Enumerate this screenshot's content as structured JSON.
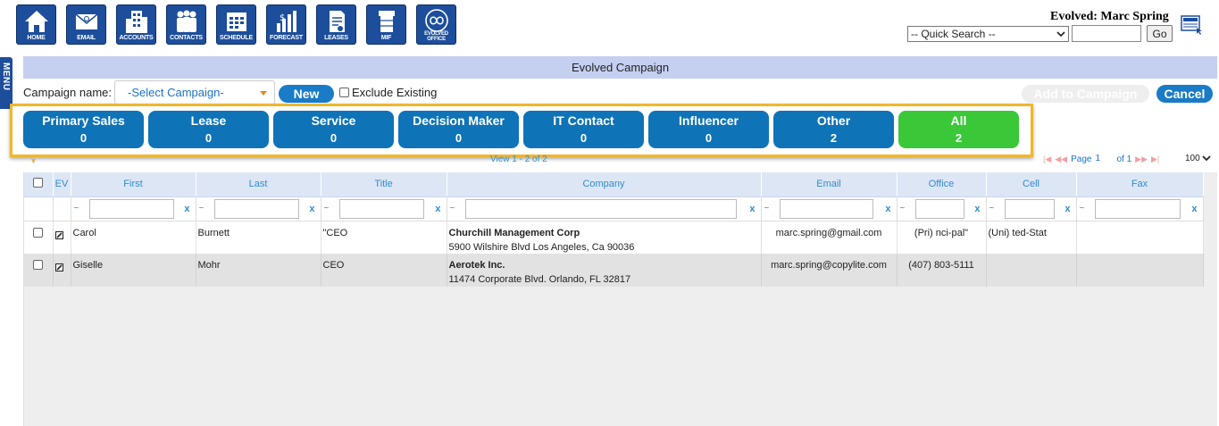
{
  "nav": {
    "items": [
      {
        "label": "HOME",
        "icon": "home-icon"
      },
      {
        "label": "EMAIL",
        "icon": "email-icon"
      },
      {
        "label": "ACCOUNTS",
        "icon": "accounts-icon"
      },
      {
        "label": "CONTACTS",
        "icon": "contacts-icon"
      },
      {
        "label": "SCHEDULE",
        "icon": "schedule-icon"
      },
      {
        "label": "FORECAST",
        "icon": "forecast-icon"
      },
      {
        "label": "LEASES",
        "icon": "leases-icon"
      },
      {
        "label": "MIF",
        "icon": "mif-icon"
      },
      {
        "label": "EVOLVED OFFICE",
        "icon": "evolved-office-icon"
      }
    ]
  },
  "header": {
    "user_name": "Evolved: Marc Spring",
    "quick_search_value": "-- Quick Search --",
    "go_label": "Go",
    "news_icon": "news-icon"
  },
  "menu_tab": {
    "label": "MENU"
  },
  "page": {
    "title": "Evolved Campaign"
  },
  "campaign": {
    "label": "Campaign name:",
    "select_value": "-Select Campaign-",
    "new_label": "New",
    "exclude_label": "Exclude Existing",
    "add_label": "Add to Campaign",
    "cancel_label": "Cancel"
  },
  "categories": [
    {
      "name": "Primary Sales",
      "count": "0"
    },
    {
      "name": "Lease",
      "count": "0"
    },
    {
      "name": "Service",
      "count": "0"
    },
    {
      "name": "Decision Maker",
      "count": "0"
    },
    {
      "name": "IT Contact",
      "count": "0"
    },
    {
      "name": "Influencer",
      "count": "0"
    },
    {
      "name": "Other",
      "count": "2"
    },
    {
      "name": "All",
      "count": "2"
    }
  ],
  "pager": {
    "view_text": "View 1 - 2 of 2",
    "page_label": "Page",
    "page_value": "1",
    "of_label": "of 1",
    "rows_value": "100"
  },
  "grid": {
    "columns": [
      "EV",
      "First",
      "Last",
      "Title",
      "Company",
      "Email",
      "Office",
      "Cell",
      "Fax"
    ],
    "rows": [
      {
        "first": "Carol",
        "last": "Burnett",
        "title": "\"CEO",
        "company": "Churchill Management Corp",
        "address": "5900 Wilshire Blvd Los Angeles, Ca 90036",
        "email": "marc.spring@gmail.com",
        "office": "(Pri) nci-pal\"",
        "cell": "(Uni) ted-Stat",
        "fax": ""
      },
      {
        "first": "Giselle",
        "last": "Mohr",
        "title": "CEO",
        "company": "Aerotek Inc.",
        "address": "11474 Corporate Blvd. Orlando, FL 32817",
        "email": "marc.spring@copylite.com",
        "office": "(407) 803-5111",
        "cell": "",
        "fax": ""
      }
    ]
  },
  "colors": {
    "nav_blue": "#1d4e9c",
    "tile_blue": "#0f73b7",
    "tile_green": "#3ac838",
    "highlight": "#f0b72c",
    "title_bar": "#c5d0f1"
  }
}
